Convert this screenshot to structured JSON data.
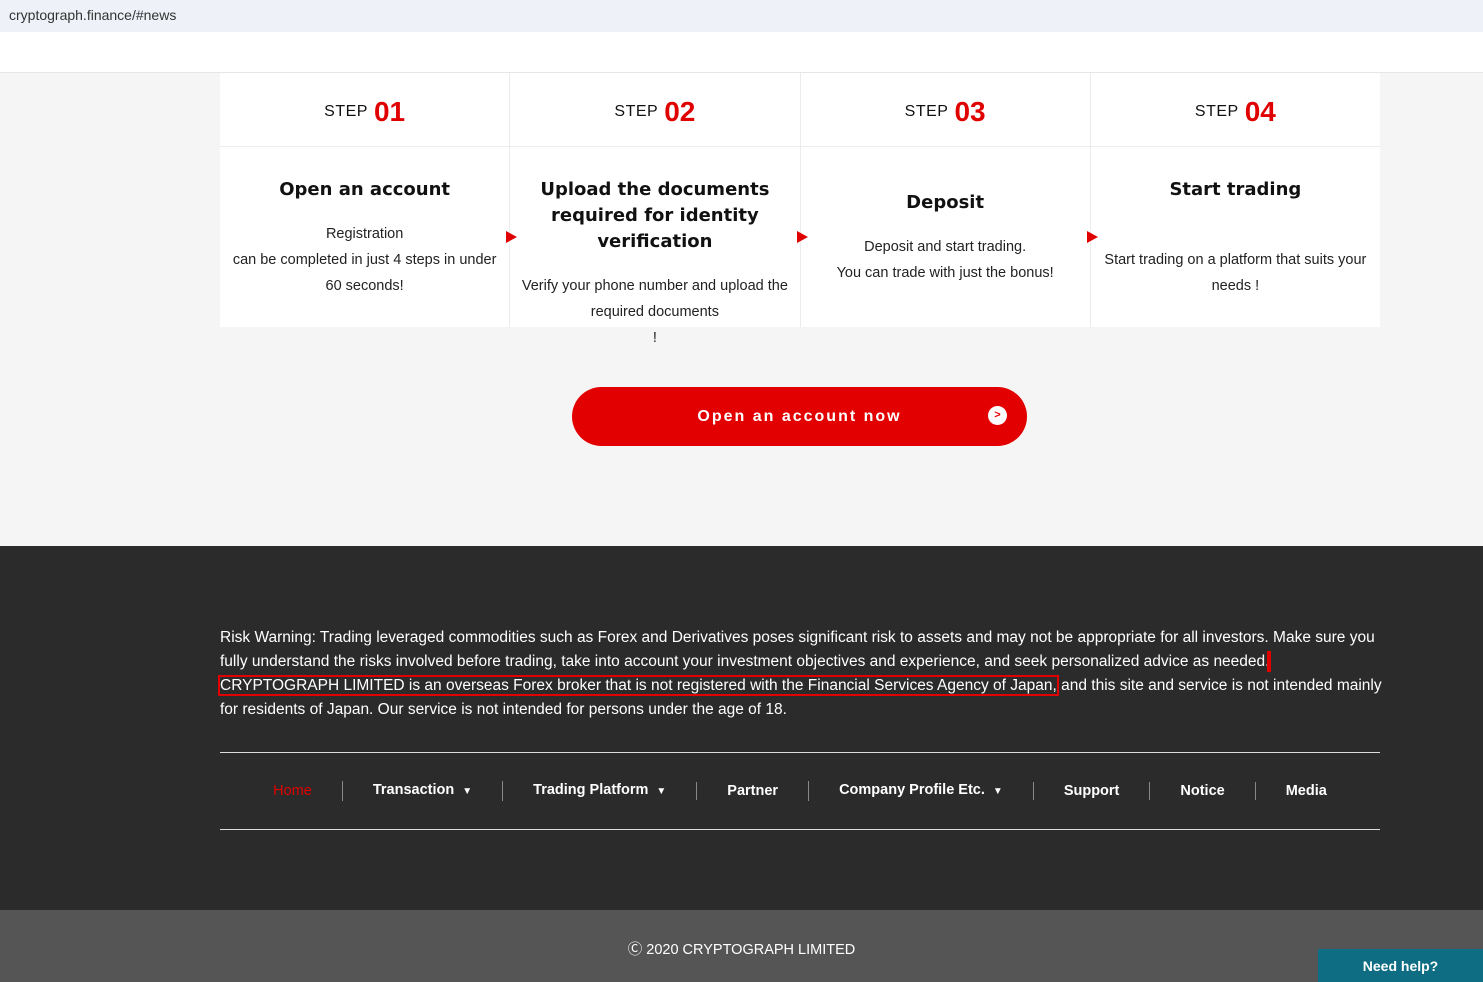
{
  "url": "cryptograph.finance/#news",
  "steps": [
    {
      "word": "STEP",
      "num": "01",
      "title": "Open an account",
      "lines": [
        "Registration",
        "can be completed in just 4 steps in under",
        "60 seconds!"
      ]
    },
    {
      "word": "STEP",
      "num": "02",
      "title": "Upload the documents required for identity verification",
      "lines": [
        "Verify your phone number and upload the",
        "required documents",
        "!"
      ]
    },
    {
      "word": "STEP",
      "num": "03",
      "title": "Deposit",
      "lines": [
        "Deposit and start trading.",
        "You can trade with just the bonus!"
      ]
    },
    {
      "word": "STEP",
      "num": "04",
      "title": "Start trading",
      "lines": [
        "Start trading on a platform that suits your",
        "needs !"
      ]
    }
  ],
  "cta": "Open an account now",
  "risk": {
    "a": "Risk Warning: Trading leveraged commodities such as Forex and Derivatives poses significant risk to assets and may not be appropriate for all investors. Make sure you fully understand the risks involved before trading, take into account your investment objectives and experience, and seek personalized advice as needed.",
    "b": " CRYPTOGRAPH LIMITED is an overseas Forex broker that is not registered with the Financial Services Agency of Japan,",
    "c": " and this site and service is not intended mainly for residents of Japan. Our service is not intended for persons under the age of 18."
  },
  "nav": [
    "Home",
    "Transaction",
    "Trading Platform",
    "Partner",
    "Company Profile Etc.",
    "Support",
    "Notice",
    "Media"
  ],
  "copyright": "Ⓒ 2020 CRYPTOGRAPH LIMITED",
  "help": "Need help?",
  "colors": {
    "accent": "#e20000",
    "footer": "#2b2b2b",
    "help": "#0e6d83"
  }
}
